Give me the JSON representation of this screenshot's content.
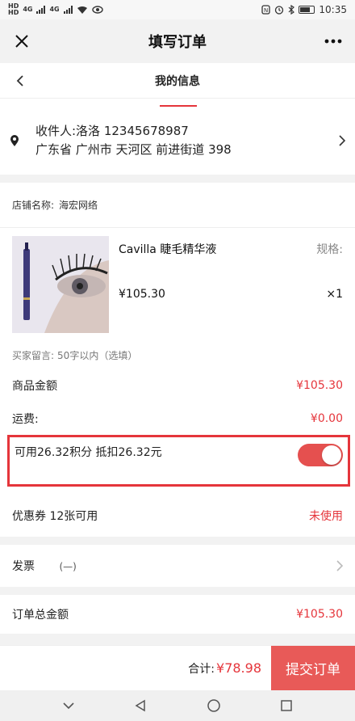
{
  "status_bar": {
    "left_mini_top": "HD",
    "left_mini_bottom": "HD",
    "network_1": "4G",
    "network_2": "4G",
    "time": "10:35",
    "icons": [
      "nfc-icon",
      "alarm-icon",
      "bluetooth-icon",
      "battery-icon"
    ]
  },
  "topbar": {
    "title": "填写订单",
    "close_icon": "close-icon",
    "more_icon": "more-icon"
  },
  "subheader": {
    "title": "我的信息"
  },
  "address": {
    "recipient_line": "收件人:洛洛 12345678987",
    "address_line": "广东省 广州市 天河区 前进街道 398"
  },
  "store": {
    "label": "店铺名称:",
    "name": "海宏网络"
  },
  "product": {
    "name": "Cavilla 睫毛精华液",
    "spec_label": "规格:",
    "price": "¥105.30",
    "quantity": "×1"
  },
  "note": {
    "label": "买家留言:",
    "placeholder": "50字以内（选填）"
  },
  "summary": {
    "goods_amount_label": "商品金额",
    "goods_amount_value": "¥105.30",
    "shipping_label": "运费:",
    "shipping_value": "¥0.00",
    "points_text": "可用26.32积分 抵扣26.32元",
    "points_enabled": true,
    "coupon_label": "优惠券 12张可用",
    "coupon_value": "未使用",
    "invoice_label": "发票",
    "invoice_value": "(—)",
    "order_total_label": "订单总金额",
    "order_total_value": "¥105.30"
  },
  "bottom_bar": {
    "total_label": "合计:",
    "total_value": "¥78.98",
    "submit_label": "提交订单"
  },
  "colors": {
    "accent": "#e5353b",
    "submit_bg": "#e85a58",
    "toggle_on": "#e5504f"
  }
}
